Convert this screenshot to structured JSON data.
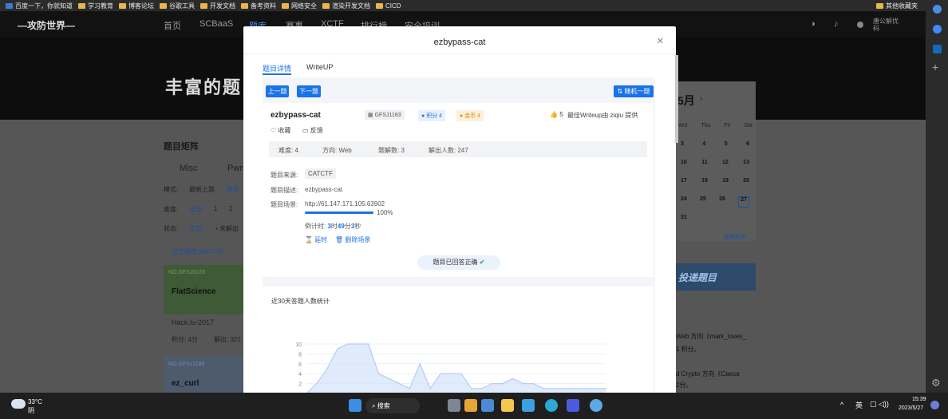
{
  "bookmarks": {
    "items": [
      "百度一下，你就知道",
      "学习教育",
      "博客论坛",
      "谷歌工具",
      "开发文档",
      "备考资料",
      "网络安全",
      "渲染开发文档",
      "CICD"
    ],
    "right": "其他收藏夹"
  },
  "site": {
    "logo": "—攻防世界—",
    "nav": [
      "首页",
      "SCBaaS",
      "题库",
      "赛事",
      "XCTF",
      "排行榜",
      "安全培训"
    ],
    "user": "唐公解优码",
    "banner_text": "丰富的题目",
    "matrix_title": "题目矩阵",
    "categories": [
      "Misc",
      "Pwn"
    ],
    "mode_label": "模式:",
    "mode_value": "最新上题",
    "mode_extra": "新手",
    "difficulty_label": "难度:",
    "difficulty_all": "全部",
    "difficulty_1": "1",
    "difficulty_2": "2",
    "status_label": "状态:",
    "status_all": "全部",
    "status_unsolved": "未解出",
    "official_bank": "官方题库 (84/779)",
    "cards": [
      {
        "no": "NO.GFSJ0223",
        "title": "FlatScience",
        "source": "Hack.lu-2017",
        "points": "积分: 4分",
        "solved": "解出: 321"
      },
      {
        "no": "NO.GFSJ1188",
        "title": "ez_curl"
      }
    ],
    "calendar": {
      "month": "5月",
      "weekdays": [
        "Wed",
        "Thu",
        "Fri",
        "Sat"
      ],
      "rows": [
        [
          "3",
          "4",
          "5",
          "6"
        ],
        [
          "10",
          "11",
          "12",
          "13"
        ],
        [
          "17",
          "18",
          "19",
          "20"
        ],
        [
          "24",
          "25",
          "26",
          "27"
        ],
        [
          "31",
          "",
          "",
          ""
        ]
      ],
      "more": "签到规则"
    },
    "submit_banner": "投递题目",
    "feed": [
      "Web 方向《mark_loves_",
      "1 积分。",
      "d Crypto 方向《Caesa",
      "2分。"
    ]
  },
  "modal": {
    "title": "ezbypass-cat",
    "tabs": [
      "题目详情",
      "WriteUP"
    ],
    "prev": "上一题",
    "next": "下一题",
    "random": "随机一题",
    "challenge": {
      "name": "ezbypass-cat",
      "id": "GFSJ1183",
      "score_badge": "积分 4",
      "coin_badge": "金币 4",
      "likes": "5",
      "writeup_by": "最佳Writeup由 ziqiu 提供",
      "fav": "收藏",
      "feedback": "反馈",
      "difficulty": "难度: 4",
      "direction": "方向: Web",
      "solves": "题解数: 3",
      "solvers": "解出人数: 247",
      "source_label": "题目来源:",
      "source": "CATCTF",
      "desc_label": "题目描述:",
      "desc": "ezbypass-cat",
      "scene_label": "题目场景:",
      "scene_url": "http://61.147.171.105:63902",
      "progress": 1.0,
      "progress_text": "100%",
      "countdown_label": "倒计时:",
      "countdown_h": "3",
      "countdown_h_unit": "时",
      "countdown_m": "49",
      "countdown_m_unit": "分",
      "countdown_s": "3",
      "countdown_s_unit": "秒",
      "extend": "延时",
      "delete_scene": "删除场景",
      "answered": "题目已回答正确"
    },
    "stats_title": "近30天答题人数统计"
  },
  "chart_data": {
    "type": "area",
    "title": "近30天答题人数统计",
    "y_ticks": [
      "10",
      "8",
      "6",
      "4",
      "2"
    ],
    "ylim": [
      0,
      10
    ],
    "values": [
      0,
      2,
      5,
      9,
      10,
      10,
      10,
      4,
      3,
      2,
      1,
      6,
      1,
      4,
      4,
      4,
      1,
      1,
      2,
      2,
      3,
      2,
      2,
      1,
      1,
      1,
      1,
      1,
      1,
      1
    ]
  },
  "taskbar": {
    "temp": "33°C",
    "weather": "阴",
    "search": "搜索",
    "time": "15:39",
    "date": "2023/5/27",
    "lang": "英"
  },
  "colors": {
    "accent": "#1a73e8",
    "success": "#2e8b57"
  }
}
